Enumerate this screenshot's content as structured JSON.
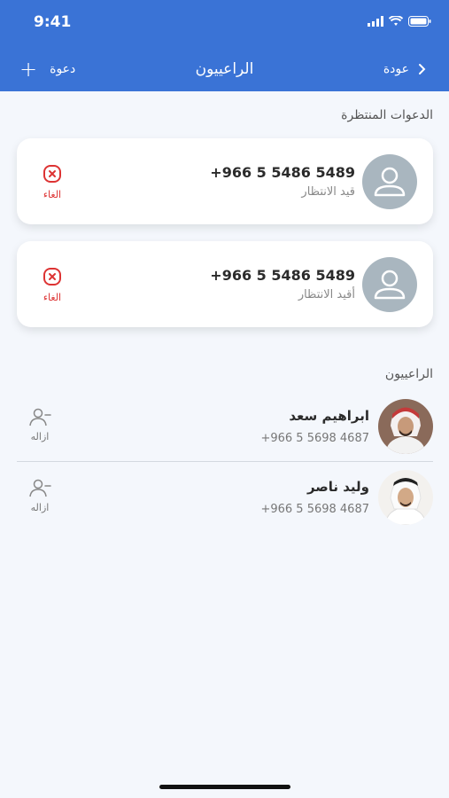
{
  "status_bar": {
    "time": "9:41"
  },
  "nav": {
    "title": "الراعييون",
    "back_label": "عودة",
    "invite_label": "دعوة"
  },
  "pending": {
    "title": "الدعوات المنتظرة",
    "items": [
      {
        "phone": "+966 5 5486 5489",
        "status": "قيد الانتظار",
        "cancel_label": "الغاء"
      },
      {
        "phone": "+966 5 5486 5489",
        "status": "أقيد الانتظار",
        "cancel_label": "الغاء"
      }
    ]
  },
  "sponsors": {
    "title": "الراعييون",
    "items": [
      {
        "name": "ابراهيم سعد",
        "phone": "+966 5 5698 4687",
        "remove_label": "ازاله"
      },
      {
        "name": "وليد ناصر",
        "phone": "+966 5 5698 4687",
        "remove_label": "ازاله"
      }
    ]
  },
  "colors": {
    "header": "#3a73d6",
    "background": "#f4f7fc",
    "danger": "#dd3333"
  }
}
